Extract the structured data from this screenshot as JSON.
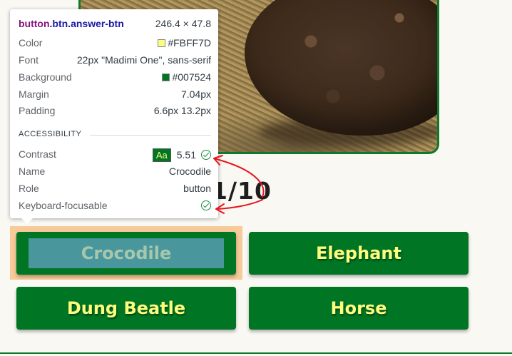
{
  "score": {
    "text": "1/10"
  },
  "answers": [
    {
      "label": "Crocodile"
    },
    {
      "label": "Elephant"
    },
    {
      "label": "Dung Beatle"
    },
    {
      "label": "Horse"
    }
  ],
  "tooltip": {
    "selector_tag": "button",
    "selector_class": ".btn.answer-btn",
    "dimensions": "246.4 × 47.8",
    "rows": {
      "color_key": "Color",
      "color_value": "#FBFF7D",
      "font_key": "Font",
      "font_value": "22px \"Madimi One\", sans-serif",
      "background_key": "Background",
      "background_value": "#007524",
      "margin_key": "Margin",
      "margin_value": "7.04px",
      "padding_key": "Padding",
      "padding_value": "6.6px 13.2px"
    },
    "accessibility_title": "ACCESSIBILITY",
    "a11y": {
      "contrast_key": "Contrast",
      "contrast_badge": "Aa",
      "contrast_value": "5.51",
      "name_key": "Name",
      "name_value": "Crocodile",
      "role_key": "Role",
      "role_value": "button",
      "focus_key": "Keyboard-focusable"
    }
  },
  "colors": {
    "button_bg": "#007524",
    "button_text": "#FBFF7D",
    "annotation": "#e8141b"
  }
}
